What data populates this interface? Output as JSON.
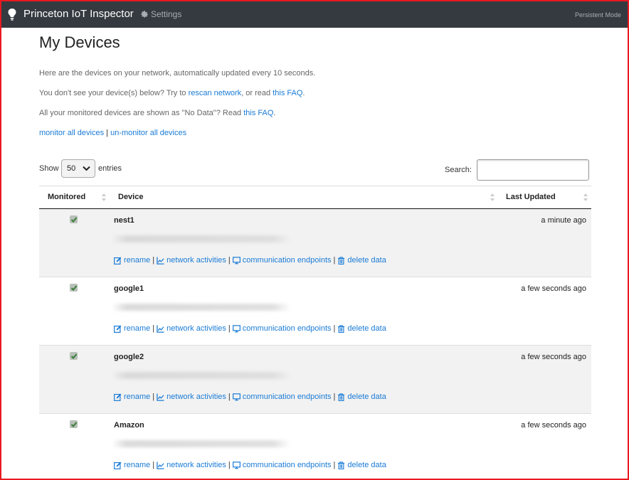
{
  "navbar": {
    "brand": "Princeton IoT Inspector",
    "settings_label": "Settings",
    "mode": "Persistent Mode"
  },
  "page": {
    "title": "My Devices",
    "intro": "Here are the devices on your network, automatically updated every 10 seconds.",
    "rescan_pre": "You don't see your device(s) below? Try to ",
    "rescan_link": "rescan network",
    "rescan_mid": ", or read ",
    "rescan_faq": "this FAQ",
    "rescan_end": ".",
    "nodata_pre": "All your monitored devices are shown as \"No Data\"? Read ",
    "nodata_faq": "this FAQ",
    "nodata_end": ".",
    "monitor_all": "monitor all devices",
    "divider": " | ",
    "unmonitor_all": "un-monitor all devices"
  },
  "table_controls": {
    "show_label": "Show",
    "page_size": "50",
    "entries_label": "entries",
    "search_label": "Search:",
    "search_value": ""
  },
  "table": {
    "columns": [
      "Monitored",
      "Device",
      "Last Updated"
    ],
    "actions": {
      "rename": "rename",
      "network": "network activities",
      "endpoints": "communication endpoints",
      "delete": "delete data"
    },
    "rows": [
      {
        "name": "nest1",
        "monitored": true,
        "updated": "a minute ago"
      },
      {
        "name": "google1",
        "monitored": true,
        "updated": "a few seconds ago"
      },
      {
        "name": "google2",
        "monitored": true,
        "updated": "a few seconds ago"
      },
      {
        "name": "Amazon",
        "monitored": true,
        "updated": "a few seconds ago"
      }
    ]
  },
  "colors": {
    "navbar": "#343a40",
    "link": "#1a7bd6",
    "row_stripe": "#f2f2f2",
    "frame": "#e8191f"
  }
}
